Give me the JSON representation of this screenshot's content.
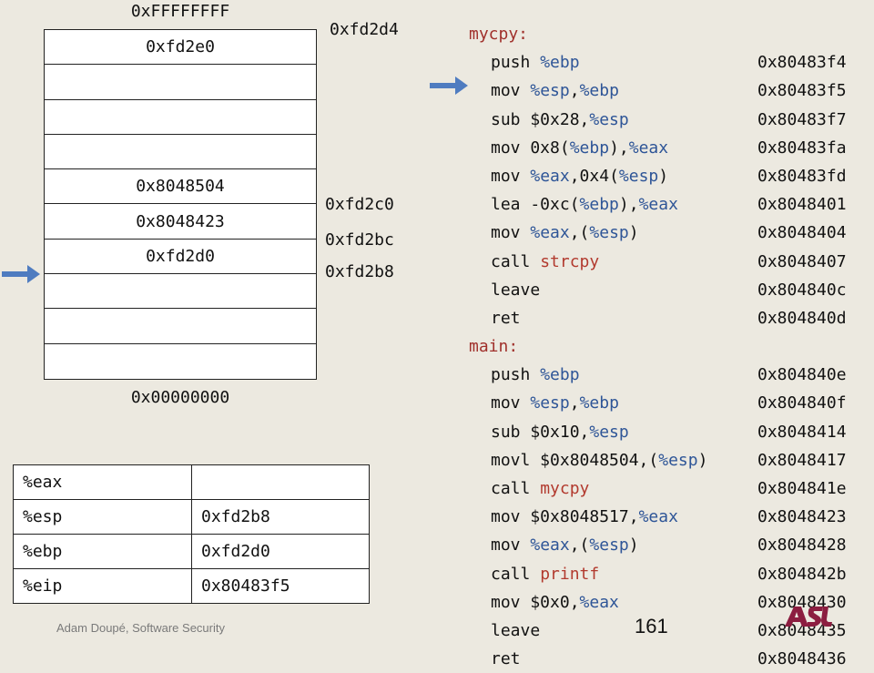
{
  "stack": {
    "top_label": "0xFFFFFFFF",
    "bottom_label": "0x00000000",
    "cells": [
      "0xfd2e0",
      "",
      "",
      "",
      "0x8048504",
      "0x8048423",
      "0xfd2d0",
      "",
      "",
      ""
    ],
    "addresses": [
      "0xfd2d4",
      "0xfd2c0",
      "0xfd2bc",
      "0xfd2b8"
    ]
  },
  "registers": [
    {
      "name": "%eax",
      "value": ""
    },
    {
      "name": "%esp",
      "value": "0xfd2b8"
    },
    {
      "name": "%ebp",
      "value": "0xfd2d0"
    },
    {
      "name": "%eip",
      "value": "0x80483f5"
    }
  ],
  "code": {
    "mycpy_label": "mycpy:",
    "main_label": "main:",
    "mycpy": [
      {
        "instr": "push %ebp",
        "addr": "0x80483f4"
      },
      {
        "instr": "mov %esp,%ebp",
        "addr": "0x80483f5"
      },
      {
        "instr": "sub $0x28,%esp",
        "addr": "0x80483f7"
      },
      {
        "instr": "mov 0x8(%ebp),%eax",
        "addr": "0x80483fa"
      },
      {
        "instr": "mov %eax,0x4(%esp)",
        "addr": "0x80483fd"
      },
      {
        "instr": "lea -0xc(%ebp),%eax",
        "addr": "0x8048401"
      },
      {
        "instr": "mov %eax,(%esp)",
        "addr": "0x8048404"
      },
      {
        "instr": "call strcpy",
        "addr": "0x8048407"
      },
      {
        "instr": "leave",
        "addr": "0x804840c"
      },
      {
        "instr": "ret",
        "addr": "0x804840d"
      }
    ],
    "main": [
      {
        "instr": "push %ebp",
        "addr": "0x804840e"
      },
      {
        "instr": "mov %esp,%ebp",
        "addr": "0x804840f"
      },
      {
        "instr": "sub $0x10,%esp",
        "addr": "0x8048414"
      },
      {
        "instr": "movl $0x8048504,(%esp)",
        "addr": "0x8048417"
      },
      {
        "instr": "call mycpy",
        "addr": "0x804841e"
      },
      {
        "instr": "mov $0x8048517,%eax",
        "addr": "0x8048423"
      },
      {
        "instr": "mov %eax,(%esp)",
        "addr": "0x8048428"
      },
      {
        "instr": "call printf",
        "addr": "0x804842b"
      },
      {
        "instr": "mov $0x0,%eax",
        "addr": "0x8048430"
      },
      {
        "instr": "leave",
        "addr": "0x8048435"
      },
      {
        "instr": "ret",
        "addr": "0x8048436"
      }
    ]
  },
  "footer": {
    "author": "Adam Doupé, Software Security",
    "page_number": "161"
  },
  "icons": {
    "code_arrow": "arrow-right-icon",
    "stack_arrow": "arrow-right-icon",
    "logo": "asu-logo"
  },
  "colors": {
    "background": "#ECE9E0",
    "register_text": "#2E5597",
    "function_text": "#B23A2E",
    "label_text": "#A0302B",
    "arrow": "#4F7CC0",
    "logo": "#8C1D40"
  }
}
